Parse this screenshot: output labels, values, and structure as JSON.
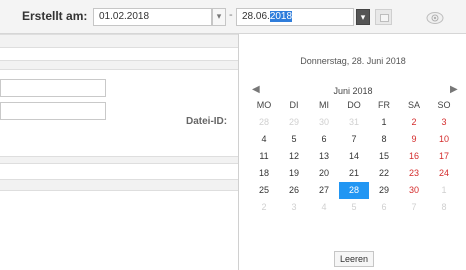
{
  "filter": {
    "label": "Erstellt am:",
    "from_value": "01.02.2018",
    "separator": "-",
    "to_value_prefix": "28.06.",
    "to_value_selected": "2018"
  },
  "form": {
    "datei_id_label": "Datei-ID:"
  },
  "calendar": {
    "header": "Donnerstag, 28. Juni 2018",
    "month_label": "Juni 2018",
    "weekdays": [
      "MO",
      "DI",
      "MI",
      "DO",
      "FR",
      "SA",
      "SO"
    ],
    "weeks": [
      [
        "28",
        "29",
        "30",
        "31",
        "1",
        "2",
        "3"
      ],
      [
        "4",
        "5",
        "6",
        "7",
        "8",
        "9",
        "10"
      ],
      [
        "11",
        "12",
        "13",
        "14",
        "15",
        "16",
        "17"
      ],
      [
        "18",
        "19",
        "20",
        "21",
        "22",
        "23",
        "24"
      ],
      [
        "25",
        "26",
        "27",
        "28",
        "29",
        "30",
        "1"
      ],
      [
        "2",
        "3",
        "4",
        "5",
        "6",
        "7",
        "8"
      ]
    ],
    "selected_day": "28",
    "clear_label": "Leeren",
    "colors": {
      "selected_bg": "#2196f3",
      "weekend": "#d42c2c",
      "muted": "#d0d0d0"
    }
  }
}
